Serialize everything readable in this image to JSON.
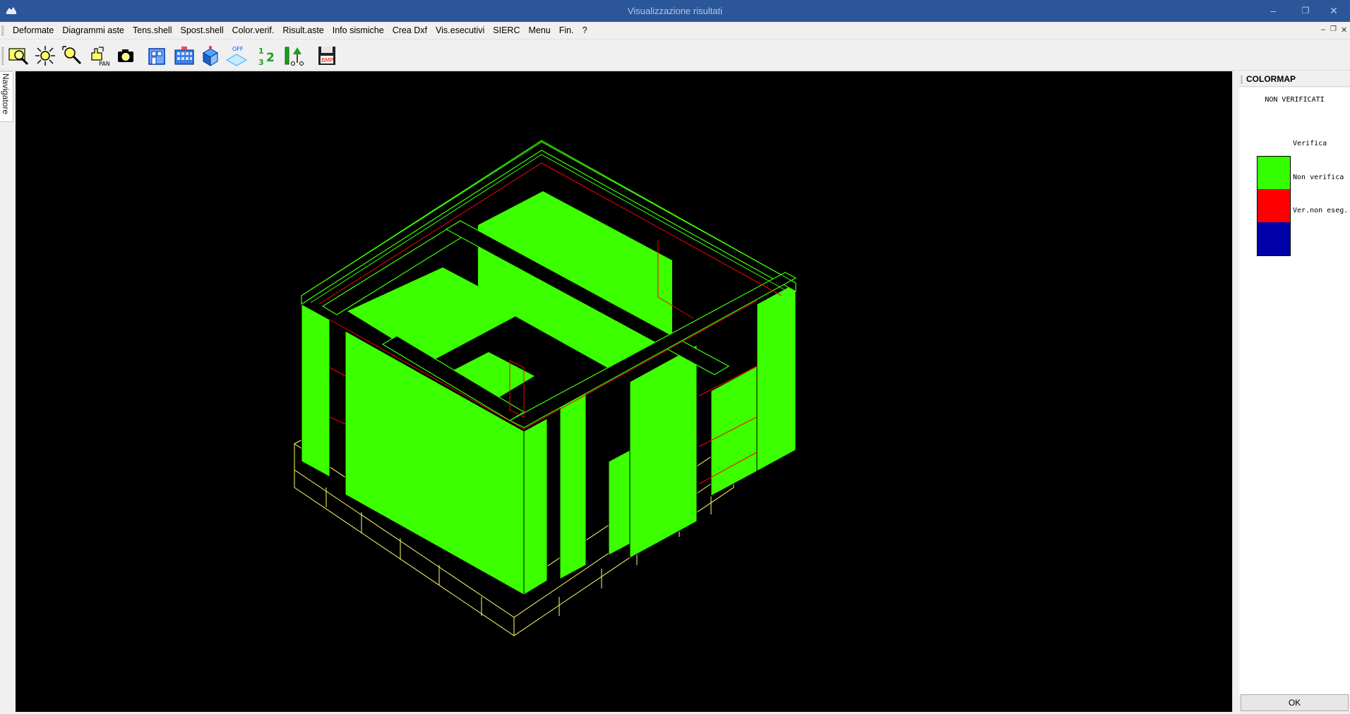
{
  "window": {
    "title": "Visualizzazione risultati",
    "minimize": "–",
    "restore": "❐",
    "close": "✕"
  },
  "menu": {
    "items": [
      "Deformate",
      "Diagrammi aste",
      "Tens.shell",
      "Spost.shell",
      "Color.verif.",
      "Risult.aste",
      "Info sismiche",
      "Crea Dxf",
      "Vis.esecutivi",
      "SIERC",
      "Menu",
      "Fin.",
      "?"
    ],
    "mdi_minimize": "–",
    "mdi_restore": "❐",
    "mdi_close": "✕"
  },
  "toolbar": {
    "buttons": [
      "zoom-window-icon",
      "zoom-extents-icon",
      "zoom-in-icon",
      "pan-icon",
      "camera-icon",
      "front-view-icon",
      "building-view-icon",
      "3d-view-icon",
      "off-layer-icon",
      "numbering-icon",
      "axes-icon",
      "save-bmp-icon"
    ],
    "pan_text": "PAN",
    "off_text": "OFF",
    "bmp_text": "BMP",
    "num_one": "1",
    "num_two": "2",
    "num_three": "3"
  },
  "navigator": {
    "label": "Navigatore"
  },
  "colormap": {
    "title": "COLORMAP",
    "subtitle": "NON VERIFICATI",
    "legend": [
      {
        "label": "Verifica",
        "color": "#33ff00"
      },
      {
        "label": "Non verifica",
        "color": "#ff0000"
      },
      {
        "label": "Ver.non eseg.",
        "color": "#0000a8"
      }
    ],
    "ok_label": "OK"
  },
  "colors": {
    "titlebar": "#2b579a",
    "viewport_bg": "#000000",
    "shell_ok": "#3cff00",
    "beam_fail": "#ff0000",
    "foundation": "#ffff66"
  }
}
